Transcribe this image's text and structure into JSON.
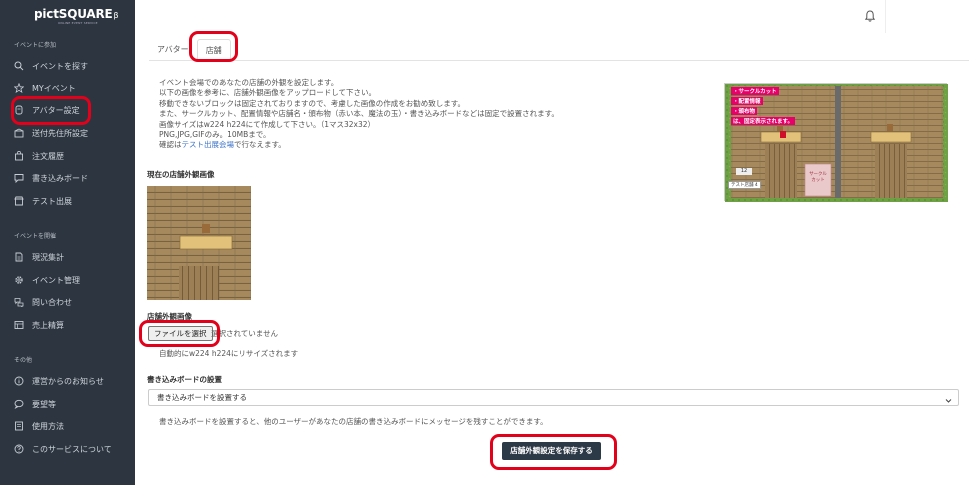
{
  "app": {
    "logo": "pictSQUARE",
    "logo_beta": "β",
    "logo_sub": "ONLINE EVENT SERVICE"
  },
  "sidebar": {
    "sections": [
      {
        "title": "イベントに参加",
        "items": [
          {
            "label": "イベントを探す",
            "icon": "search-icon"
          },
          {
            "label": "MYイベント",
            "icon": "star-icon"
          },
          {
            "label": "アバター設定",
            "icon": "avatar-icon"
          },
          {
            "label": "送付先住所設定",
            "icon": "box-icon"
          },
          {
            "label": "注文履歴",
            "icon": "cart-icon"
          },
          {
            "label": "書き込みボード",
            "icon": "chat-icon"
          },
          {
            "label": "テスト出展",
            "icon": "shop-icon"
          }
        ]
      },
      {
        "title": "イベントを開催",
        "items": [
          {
            "label": "現況集計",
            "icon": "document-icon"
          },
          {
            "label": "イベント管理",
            "icon": "gear-icon"
          },
          {
            "label": "問い合わせ",
            "icon": "chat-bubbles-icon"
          },
          {
            "label": "売上精算",
            "icon": "calculator-icon"
          }
        ]
      },
      {
        "title": "その他",
        "items": [
          {
            "label": "運営からのお知らせ",
            "icon": "info-icon"
          },
          {
            "label": "要望等",
            "icon": "speech-icon"
          },
          {
            "label": "使用方法",
            "icon": "book-icon"
          },
          {
            "label": "このサービスについて",
            "icon": "question-icon"
          }
        ]
      }
    ]
  },
  "tabs": [
    {
      "label": "アバター",
      "active": false
    },
    {
      "label": "店舗",
      "active": true
    }
  ],
  "description": {
    "lines": [
      "イベント会場でのあなたの店舗の外観を設定します。",
      "以下の画像を参考に、店舗外観画像をアップロードして下さい。",
      "移動できないブロックは固定されておりますので、考慮した画像の作成をお勧め致します。",
      "また、サークルカット、配置情報や店舗名・頒布物（赤い本、魔法の玉）・書き込みボードなどは固定で設置されます。",
      "画像サイズはw224 h224にて作成して下さい。（1マス32x32）",
      "PNG,JPG,GIFのみ。10MBまで。"
    ],
    "confirm_prefix": "確認は",
    "confirm_link": "テスト出展会場",
    "confirm_suffix": "で行なえます。"
  },
  "sample_image": {
    "badges": [
      "・サークルカット",
      "・配置情報",
      "・頒布物",
      "は、固定表示されます。"
    ],
    "space_number": "12",
    "shop_name": "テスト店舗 4",
    "circle_cut": "サークル\nカット"
  },
  "current_image": {
    "label": "現在の店舗外観画像"
  },
  "upload": {
    "label": "店舗外観画像",
    "button": "ファイルを選択",
    "status": "選択されていません",
    "note": "自動的にw224 h224にリサイズされます"
  },
  "board": {
    "label": "書き込みボードの設置",
    "selected": "書き込みボードを設置する",
    "note": "書き込みボードを設置すると、他のユーザーがあなたの店舗の書き込みボードにメッセージを残すことができます。"
  },
  "save_button": "店舗外観設定を保存する",
  "colors": {
    "sidebar": "#2d3540",
    "highlight": "#e2001a",
    "primary_button": "#2c3946",
    "link": "#3b72c6"
  }
}
